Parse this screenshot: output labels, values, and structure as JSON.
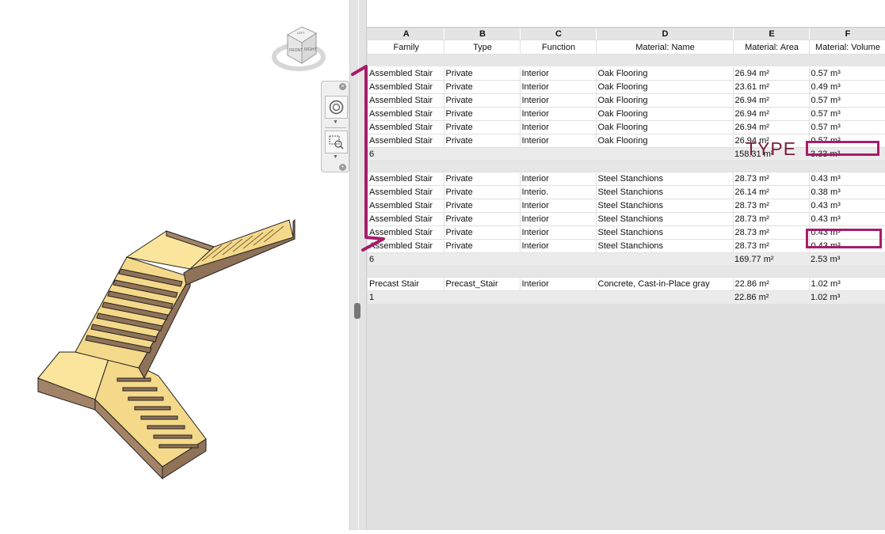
{
  "viewcube": {
    "top_label": "LEFT",
    "front_label": "FRONT",
    "right_label": "RIGHT"
  },
  "annotation": {
    "label": "TYPE",
    "color": "#a81c6a",
    "label_color": "#7a1d3c"
  },
  "schedule": {
    "column_letters": [
      "A",
      "B",
      "C",
      "D",
      "E",
      "F"
    ],
    "column_headers": [
      "Family",
      "Type",
      "Function",
      "Material: Name",
      "Material: Area",
      "Material: Volume"
    ],
    "group1": {
      "rows": [
        [
          "Assembled Stair",
          "Private",
          "Interior",
          "Oak Flooring",
          "26.94 m²",
          "0.57 m³"
        ],
        [
          "Assembled Stair",
          "Private",
          "Interior",
          "Oak Flooring",
          "23.61 m²",
          "0.49 m³"
        ],
        [
          "Assembled Stair",
          "Private",
          "Interior",
          "Oak Flooring",
          "26.94 m²",
          "0.57 m³"
        ],
        [
          "Assembled Stair",
          "Private",
          "Interior",
          "Oak Flooring",
          "26.94 m²",
          "0.57 m³"
        ],
        [
          "Assembled Stair",
          "Private",
          "Interior",
          "Oak Flooring",
          "26.94 m²",
          "0.57 m³"
        ],
        [
          "Assembled Stair",
          "Private",
          "Interior",
          "Oak Flooring",
          "26.94 m²",
          "0.57 m³"
        ]
      ],
      "subtotal": {
        "count": "6",
        "area": "158.31 m²",
        "volume": "3.33 m³"
      }
    },
    "group2": {
      "rows": [
        [
          "Assembled Stair",
          "Private",
          "Interior",
          "Steel Stanchions",
          "28.73 m²",
          "0.43 m³"
        ],
        [
          "Assembled Stair",
          "Private",
          "Interio.",
          "Steel Stanchions",
          "26.14 m²",
          "0.38 m³"
        ],
        [
          "Assembled Stair",
          "Private",
          "Interior",
          "Steel Stanchions",
          "28.73 m²",
          "0.43 m³"
        ],
        [
          "Assembled Stair",
          "Private",
          "Interior",
          "Steel Stanchions",
          "28.73 m²",
          "0.43 m³"
        ],
        [
          "Assembled Stair",
          "Private",
          "Interior",
          "Steel Stanchions",
          "28.73 m²",
          "0.43 m³"
        ],
        [
          "Assembled Stair",
          "Private",
          "Interior",
          "Steel Stanchions",
          "28.73 m²",
          "0.43 m³"
        ]
      ],
      "subtotal": {
        "count": "6",
        "area": "169.77 m²",
        "volume": "2.53 m³"
      }
    },
    "group3": {
      "rows": [
        [
          "Precast Stair",
          "Precast_Stair",
          "Interior",
          "Concrete, Cast-in-Place gray",
          "22.86 m²",
          "1.02 m³"
        ]
      ],
      "subtotal": {
        "count": "1",
        "area": "22.86 m²",
        "volume": "1.02 m³"
      }
    }
  }
}
